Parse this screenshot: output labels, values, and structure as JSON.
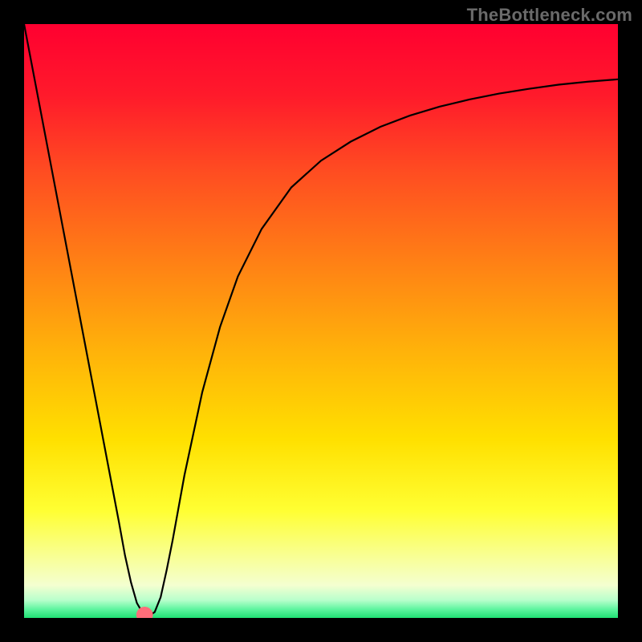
{
  "watermark": "TheBottleneck.com",
  "chart_data": {
    "type": "line",
    "title": "",
    "xlabel": "",
    "ylabel": "",
    "xlim": [
      0,
      100
    ],
    "ylim": [
      0,
      100
    ],
    "background_gradient": {
      "stops": [
        {
          "offset": 0.0,
          "color": "#ff0030"
        },
        {
          "offset": 0.12,
          "color": "#ff1a2b"
        },
        {
          "offset": 0.25,
          "color": "#ff4d21"
        },
        {
          "offset": 0.4,
          "color": "#ff8015"
        },
        {
          "offset": 0.55,
          "color": "#ffb20a"
        },
        {
          "offset": 0.7,
          "color": "#ffe000"
        },
        {
          "offset": 0.82,
          "color": "#ffff33"
        },
        {
          "offset": 0.9,
          "color": "#f8ff99"
        },
        {
          "offset": 0.945,
          "color": "#f4ffd0"
        },
        {
          "offset": 0.97,
          "color": "#b8ffcc"
        },
        {
          "offset": 0.985,
          "color": "#60f5a0"
        },
        {
          "offset": 1.0,
          "color": "#20e074"
        }
      ]
    },
    "series": [
      {
        "name": "bottleneck-curve",
        "color": "#000000",
        "width": 2.2,
        "x": [
          0,
          2,
          4,
          6,
          8,
          10,
          12,
          14,
          16,
          17,
          18,
          19,
          20,
          21,
          22,
          23,
          24,
          25,
          27,
          30,
          33,
          36,
          40,
          45,
          50,
          55,
          60,
          65,
          70,
          75,
          80,
          85,
          90,
          95,
          100
        ],
        "y": [
          100,
          89.5,
          79,
          68.5,
          58,
          47.5,
          37,
          26.5,
          16,
          10.5,
          6,
          2.5,
          0.8,
          0.3,
          1.0,
          3.5,
          8,
          13,
          24,
          38,
          49,
          57.5,
          65.5,
          72.5,
          77,
          80.2,
          82.7,
          84.6,
          86.1,
          87.3,
          88.3,
          89.1,
          89.8,
          90.3,
          90.7
        ]
      }
    ],
    "markers": [
      {
        "name": "minimum-marker",
        "x": 20.3,
        "y": 0.5,
        "r": 1.4,
        "color": "#ff6e7a"
      }
    ]
  },
  "frame": {
    "border_color": "#000000",
    "border_px": 30
  }
}
